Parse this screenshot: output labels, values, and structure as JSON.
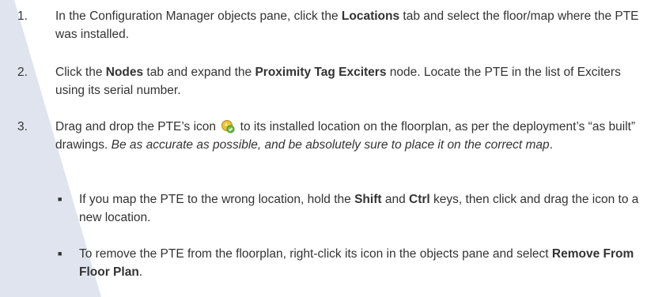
{
  "steps": [
    {
      "num": "1.",
      "pre": "In the Configuration Manager objects pane, click the ",
      "b1": "Locations",
      "post": " tab and select the floor/map where the PTE was installed."
    },
    {
      "num": "2.",
      "pre": "Click the ",
      "b1": "Nodes",
      "mid": " tab and expand the ",
      "b2": "Proximity Tag Exciters",
      "post": " node. Locate the PTE in the list of Exciters using its serial number."
    },
    {
      "num": "3.",
      "pre": "Drag and drop the PTE’s icon ",
      "post": " to its installed location on the floorplan, as per the deployment’s “as built” drawings. ",
      "italic": "Be as accurate as possible, and be absolutely sure to place it on the correct map",
      "end": ".",
      "icon": "pte-exciter-icon"
    }
  ],
  "bullets": [
    {
      "marker": "■",
      "pre": "If you map the PTE to the wrong location, hold the ",
      "b1": "Shift",
      "mid": " and ",
      "b2": "Ctrl",
      "post": " keys, then click and drag the icon to a new location."
    },
    {
      "marker": "■",
      "pre": "To remove the PTE from the floorplan, right-click its icon in the objects pane and select ",
      "b1": "Remove From Floor Plan",
      "post": "."
    }
  ],
  "colors": {
    "band": "#dfe4ee",
    "text": "#333333"
  }
}
